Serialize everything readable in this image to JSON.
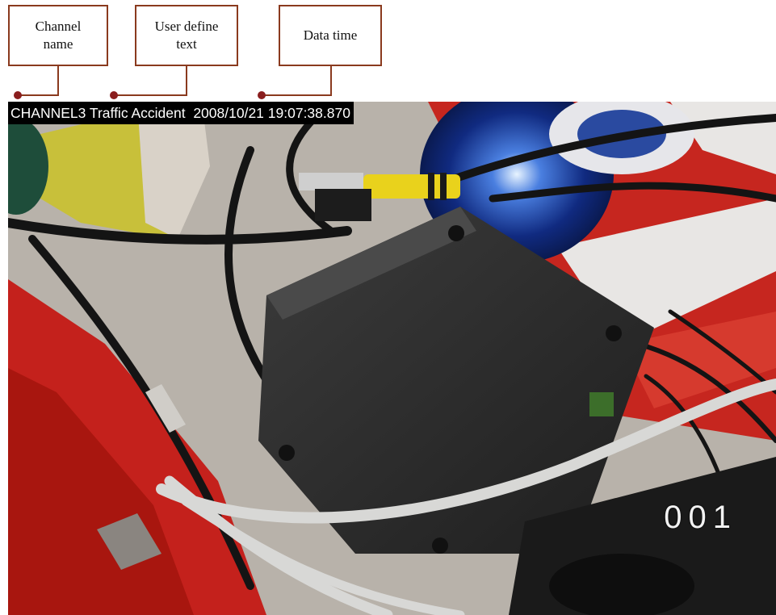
{
  "callouts": {
    "channel_name": "Channel\nname",
    "user_define_text": "User define\ntext",
    "data_time": "Data time"
  },
  "osd": {
    "channel_name": "CHANNEL3",
    "user_text": "Traffic Accident",
    "datetime": "2008/10/21 19:07:38.870",
    "counter": "001"
  },
  "colors": {
    "callout_border": "#8a3a1e",
    "osd_background": "#000000",
    "osd_text": "#ffffff"
  }
}
